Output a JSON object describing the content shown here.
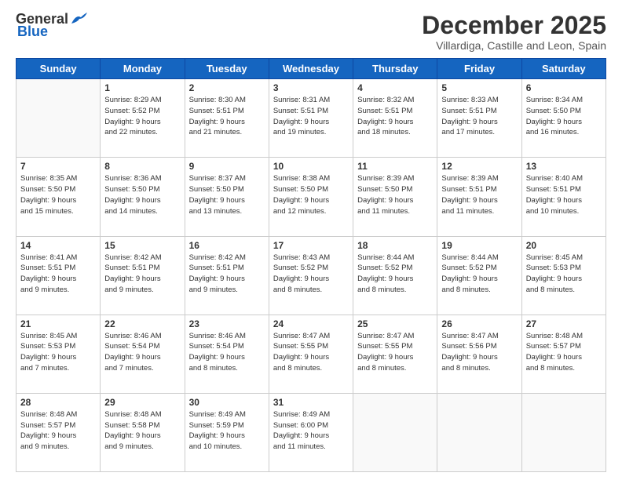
{
  "header": {
    "logo_general": "General",
    "logo_blue": "Blue",
    "month_title": "December 2025",
    "subtitle": "Villardiga, Castille and Leon, Spain"
  },
  "weekdays": [
    "Sunday",
    "Monday",
    "Tuesday",
    "Wednesday",
    "Thursday",
    "Friday",
    "Saturday"
  ],
  "weeks": [
    [
      {
        "day": "",
        "info": ""
      },
      {
        "day": "1",
        "info": "Sunrise: 8:29 AM\nSunset: 5:52 PM\nDaylight: 9 hours\nand 22 minutes."
      },
      {
        "day": "2",
        "info": "Sunrise: 8:30 AM\nSunset: 5:51 PM\nDaylight: 9 hours\nand 21 minutes."
      },
      {
        "day": "3",
        "info": "Sunrise: 8:31 AM\nSunset: 5:51 PM\nDaylight: 9 hours\nand 19 minutes."
      },
      {
        "day": "4",
        "info": "Sunrise: 8:32 AM\nSunset: 5:51 PM\nDaylight: 9 hours\nand 18 minutes."
      },
      {
        "day": "5",
        "info": "Sunrise: 8:33 AM\nSunset: 5:51 PM\nDaylight: 9 hours\nand 17 minutes."
      },
      {
        "day": "6",
        "info": "Sunrise: 8:34 AM\nSunset: 5:50 PM\nDaylight: 9 hours\nand 16 minutes."
      }
    ],
    [
      {
        "day": "7",
        "info": "Sunrise: 8:35 AM\nSunset: 5:50 PM\nDaylight: 9 hours\nand 15 minutes."
      },
      {
        "day": "8",
        "info": "Sunrise: 8:36 AM\nSunset: 5:50 PM\nDaylight: 9 hours\nand 14 minutes."
      },
      {
        "day": "9",
        "info": "Sunrise: 8:37 AM\nSunset: 5:50 PM\nDaylight: 9 hours\nand 13 minutes."
      },
      {
        "day": "10",
        "info": "Sunrise: 8:38 AM\nSunset: 5:50 PM\nDaylight: 9 hours\nand 12 minutes."
      },
      {
        "day": "11",
        "info": "Sunrise: 8:39 AM\nSunset: 5:50 PM\nDaylight: 9 hours\nand 11 minutes."
      },
      {
        "day": "12",
        "info": "Sunrise: 8:39 AM\nSunset: 5:51 PM\nDaylight: 9 hours\nand 11 minutes."
      },
      {
        "day": "13",
        "info": "Sunrise: 8:40 AM\nSunset: 5:51 PM\nDaylight: 9 hours\nand 10 minutes."
      }
    ],
    [
      {
        "day": "14",
        "info": "Sunrise: 8:41 AM\nSunset: 5:51 PM\nDaylight: 9 hours\nand 9 minutes."
      },
      {
        "day": "15",
        "info": "Sunrise: 8:42 AM\nSunset: 5:51 PM\nDaylight: 9 hours\nand 9 minutes."
      },
      {
        "day": "16",
        "info": "Sunrise: 8:42 AM\nSunset: 5:51 PM\nDaylight: 9 hours\nand 9 minutes."
      },
      {
        "day": "17",
        "info": "Sunrise: 8:43 AM\nSunset: 5:52 PM\nDaylight: 9 hours\nand 8 minutes."
      },
      {
        "day": "18",
        "info": "Sunrise: 8:44 AM\nSunset: 5:52 PM\nDaylight: 9 hours\nand 8 minutes."
      },
      {
        "day": "19",
        "info": "Sunrise: 8:44 AM\nSunset: 5:52 PM\nDaylight: 9 hours\nand 8 minutes."
      },
      {
        "day": "20",
        "info": "Sunrise: 8:45 AM\nSunset: 5:53 PM\nDaylight: 9 hours\nand 8 minutes."
      }
    ],
    [
      {
        "day": "21",
        "info": "Sunrise: 8:45 AM\nSunset: 5:53 PM\nDaylight: 9 hours\nand 7 minutes."
      },
      {
        "day": "22",
        "info": "Sunrise: 8:46 AM\nSunset: 5:54 PM\nDaylight: 9 hours\nand 7 minutes."
      },
      {
        "day": "23",
        "info": "Sunrise: 8:46 AM\nSunset: 5:54 PM\nDaylight: 9 hours\nand 8 minutes."
      },
      {
        "day": "24",
        "info": "Sunrise: 8:47 AM\nSunset: 5:55 PM\nDaylight: 9 hours\nand 8 minutes."
      },
      {
        "day": "25",
        "info": "Sunrise: 8:47 AM\nSunset: 5:55 PM\nDaylight: 9 hours\nand 8 minutes."
      },
      {
        "day": "26",
        "info": "Sunrise: 8:47 AM\nSunset: 5:56 PM\nDaylight: 9 hours\nand 8 minutes."
      },
      {
        "day": "27",
        "info": "Sunrise: 8:48 AM\nSunset: 5:57 PM\nDaylight: 9 hours\nand 8 minutes."
      }
    ],
    [
      {
        "day": "28",
        "info": "Sunrise: 8:48 AM\nSunset: 5:57 PM\nDaylight: 9 hours\nand 9 minutes."
      },
      {
        "day": "29",
        "info": "Sunrise: 8:48 AM\nSunset: 5:58 PM\nDaylight: 9 hours\nand 9 minutes."
      },
      {
        "day": "30",
        "info": "Sunrise: 8:49 AM\nSunset: 5:59 PM\nDaylight: 9 hours\nand 10 minutes."
      },
      {
        "day": "31",
        "info": "Sunrise: 8:49 AM\nSunset: 6:00 PM\nDaylight: 9 hours\nand 11 minutes."
      },
      {
        "day": "",
        "info": ""
      },
      {
        "day": "",
        "info": ""
      },
      {
        "day": "",
        "info": ""
      }
    ]
  ]
}
